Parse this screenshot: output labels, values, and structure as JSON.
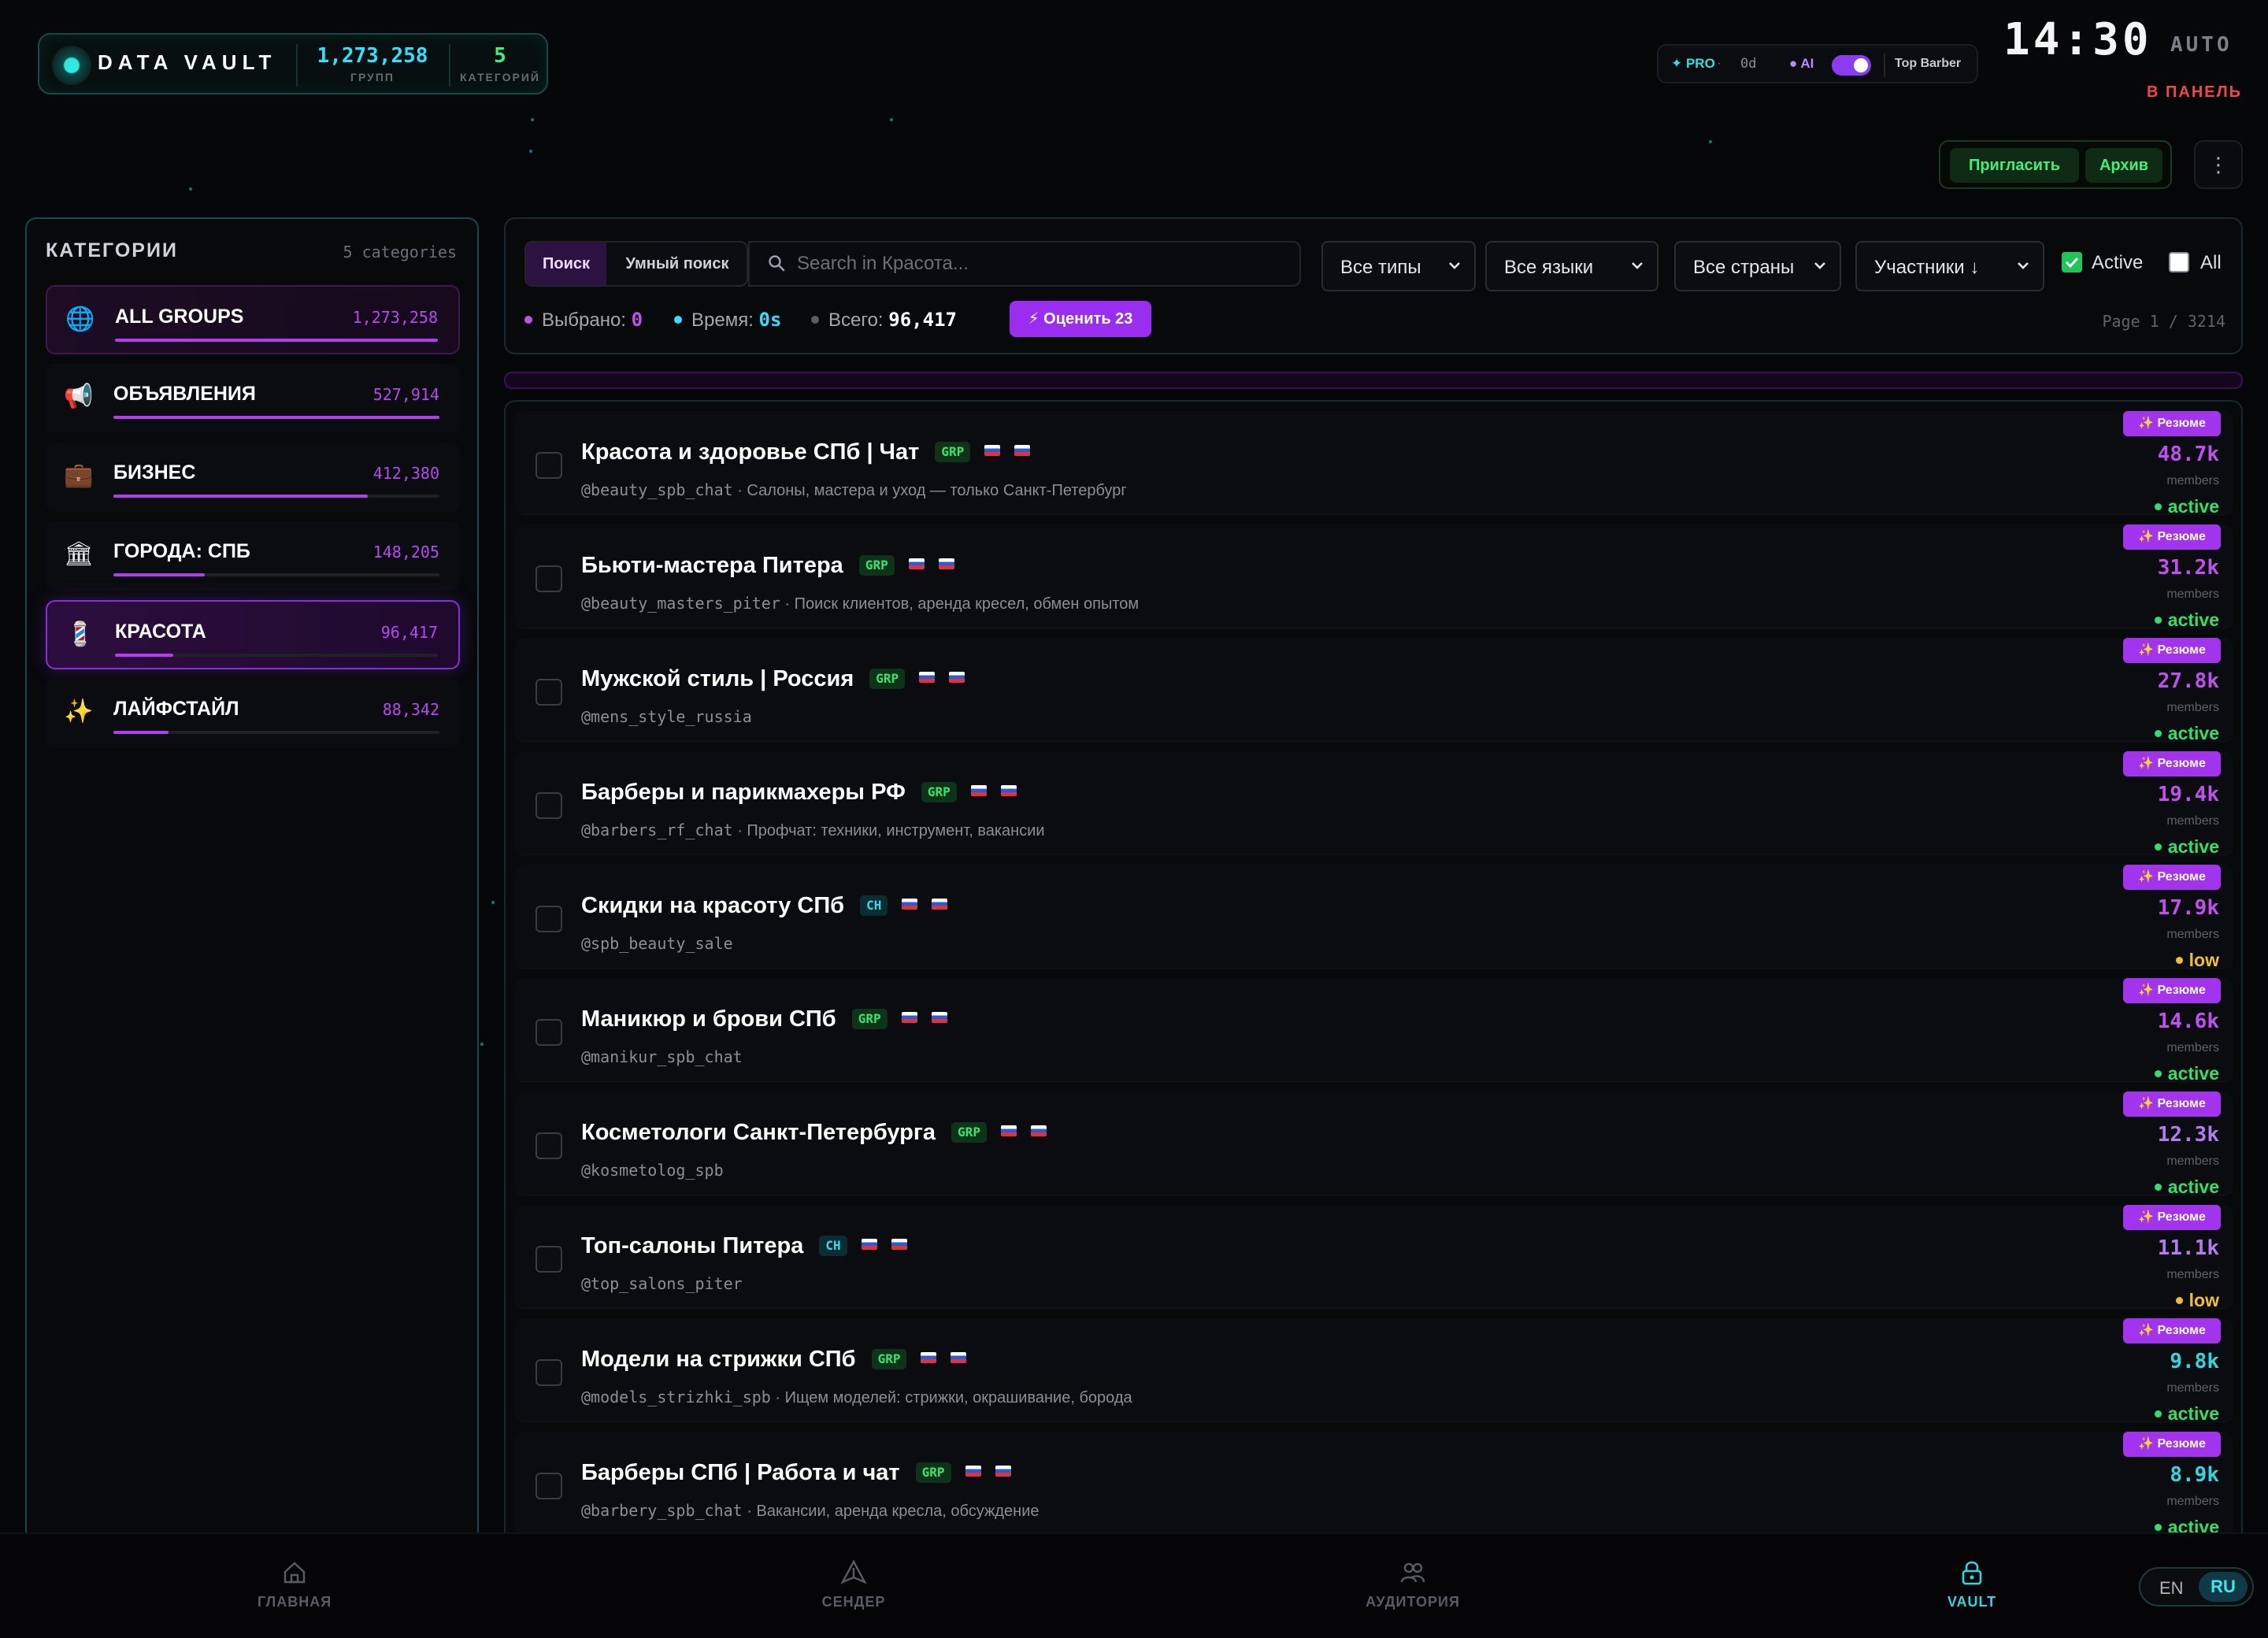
{
  "brand": {
    "title": "DATA VAULT",
    "groups_value": "1,273,258",
    "groups_label": "ГРУПП",
    "categories_value": "5",
    "categories_label": "КАТЕГОРИЙ"
  },
  "status": {
    "pro": "✦ PRO",
    "separator": "·",
    "days": "0d",
    "ai": "● AI",
    "ai_enabled": true,
    "brand_name": "Top Barber"
  },
  "clock": {
    "time": "14:30",
    "mode": "AUTO",
    "panel_link": "В ПАНЕЛЬ"
  },
  "actions": {
    "invite": "Пригласить",
    "archive": "Архив",
    "more": "⋮"
  },
  "sidebar": {
    "title": "КАТЕГОРИИ",
    "count": "5 categories",
    "items": [
      {
        "icon": "🌐",
        "icon_name": "globe-icon",
        "label": "ALL GROUPS",
        "count": "1,273,258",
        "share": 1.0
      },
      {
        "icon": "📢",
        "icon_name": "megaphone-icon",
        "label": "ОБЪЯВЛЕНИЯ",
        "count": "527,914",
        "share": 1.0
      },
      {
        "icon": "💼",
        "icon_name": "briefcase-icon",
        "label": "БИЗНЕС",
        "count": "412,380",
        "share": 0.78
      },
      {
        "icon": "🏛",
        "icon_name": "building-icon",
        "label": "ГОРОДА: СПБ",
        "count": "148,205",
        "share": 0.28
      },
      {
        "icon": "💈",
        "icon_name": "barber-pole-icon",
        "label": "КРАСОТА",
        "count": "96,417",
        "share": 0.18
      },
      {
        "icon": "✨",
        "icon_name": "sparkles-icon",
        "label": "ЛАЙФСТАЙЛ",
        "count": "88,342",
        "share": 0.17
      }
    ]
  },
  "filters": {
    "tab_search": "Поиск",
    "tab_smart": "Умный поиск",
    "search_placeholder": "Search in Красота...",
    "search_value": "",
    "type": "Все типы",
    "language": "Все языки",
    "country": "Все страны",
    "sort": "Участники ↓",
    "active_label": "Active",
    "active_checked": true,
    "all_label": "All",
    "all_checked": false
  },
  "meta": {
    "selected_label": "Выбрано:",
    "selected_value": "0",
    "time_label": "Время:",
    "time_value": "0s",
    "total_label": "Всего:",
    "total_value": "96,417",
    "rate_button": "⚡ Оценить 23",
    "page": "Page 1 / 3214"
  },
  "list": {
    "resume_label": "✨ Резюме",
    "members_label": "members",
    "rows": [
      {
        "title": "Красота и здоровье СПб | Чат",
        "tag": "GRP",
        "handle": "@beauty_spb_chat",
        "desc": " · Салоны, мастера и уход — только Санкт-Петербург",
        "members": "48.7k",
        "status": "active"
      },
      {
        "title": "Бьюти-мастера Питера",
        "tag": "GRP",
        "handle": "@beauty_masters_piter",
        "desc": " · Поиск клиентов, аренда кресел, обмен опытом",
        "members": "31.2k",
        "status": "active"
      },
      {
        "title": "Мужской стиль | Россия",
        "tag": "GRP",
        "handle": "@mens_style_russia",
        "desc": "",
        "members": "27.8k",
        "status": "active"
      },
      {
        "title": "Барберы и парикмахеры РФ",
        "tag": "GRP",
        "handle": "@barbers_rf_chat",
        "desc": " · Профчат: техники, инструмент, вакансии",
        "members": "19.4k",
        "status": "active"
      },
      {
        "title": "Скидки на красоту СПб",
        "tag": "CH",
        "handle": "@spb_beauty_sale",
        "desc": "",
        "members": "17.9k",
        "status": "low"
      },
      {
        "title": "Маникюр и брови СПб",
        "tag": "GRP",
        "handle": "@manikur_spb_chat",
        "desc": "",
        "members": "14.6k",
        "status": "active"
      },
      {
        "title": "Косметологи Санкт-Петербурга",
        "tag": "GRP",
        "handle": "@kosmetolog_spb",
        "desc": "",
        "members": "12.3k",
        "status": "active"
      },
      {
        "title": "Топ-салоны Питера",
        "tag": "CH",
        "handle": "@top_salons_piter",
        "desc": "",
        "members": "11.1k",
        "status": "low"
      },
      {
        "title": "Модели на стрижки СПб",
        "tag": "GRP",
        "handle": "@models_strizhki_spb",
        "desc": " · Ищем моделей: стрижки, окрашивание, борода",
        "members": "9.8k",
        "status": "active"
      },
      {
        "title": "Барберы СПб | Работа и чат",
        "tag": "GRP",
        "handle": "@barbery_spb_chat",
        "desc": " · Вакансии, аренда кресла, обсуждение",
        "members": "8.9k",
        "status": "active"
      }
    ]
  },
  "nav": {
    "home": "ГЛАВНАЯ",
    "sender": "СЕНДЕР",
    "audience": "АУДИТОРИЯ",
    "vault": "VAULT",
    "lang_en": "EN",
    "lang_ru": "RU"
  },
  "colors": {
    "accent_teal": "#2fe0da",
    "accent_purple": "#a234ee",
    "active_green": "#2fe06a",
    "low_yellow": "#f0c030",
    "background": "#050608"
  }
}
